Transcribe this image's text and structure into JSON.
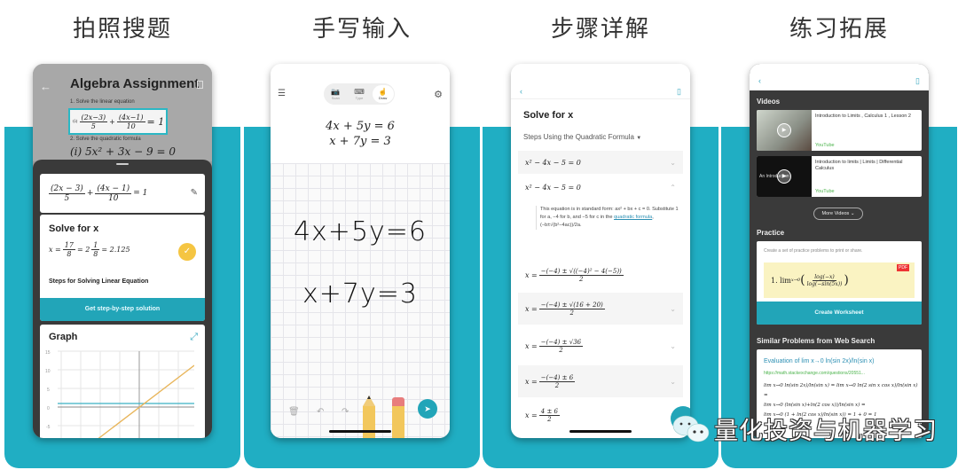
{
  "colors": {
    "teal": "#20aec3",
    "button_teal": "#22a5b8",
    "check_yellow": "#f5c542",
    "link_blue": "#2b8fb3",
    "source_green": "#4bb34b"
  },
  "panels": [
    {
      "title": "拍照搜题",
      "scan": {
        "back_icon": "←",
        "heading": "Algebra Assignment",
        "line1": "1. Solve the linear equation",
        "eq1_label": "(i)",
        "eq1": {
          "a_num": "(2x−3)",
          "a_den": "5",
          "plus": "+",
          "b_num": "(4x−1)",
          "b_den": "10",
          "rhs": "= 1"
        },
        "line2": "2. Solve the quadratic formula",
        "eq2": "(i) 5x² + 3x − 9 = 0"
      },
      "problem_card": {
        "a_num": "(2x − 3)",
        "a_den": "5",
        "plus": "+",
        "b_num": "(4x − 1)",
        "b_den": "10",
        "rhs": "= 1",
        "edit_icon": "✎"
      },
      "solve_card": {
        "title": "Solve for x",
        "result_lhs": "x =",
        "frac_num": "17",
        "frac_den": "8",
        "mixed": "= 2",
        "mixed_num": "1",
        "mixed_den": "8",
        "decimal": "= 2.125",
        "check_icon": "✓",
        "steps_label": "Steps for Solving Linear Equation",
        "button": "Get step-by-step solution"
      },
      "graph_card": {
        "title": "Graph",
        "expand_icon": "⤢",
        "y_ticks": [
          "15",
          "10",
          "5",
          "0",
          "-5"
        ]
      }
    },
    {
      "title": "手写输入",
      "list_icon": "☰",
      "gear_icon": "⚙",
      "modes": [
        {
          "icon": "📷",
          "label": "Scan"
        },
        {
          "icon": "⌨",
          "label": "Type"
        },
        {
          "icon": "☝",
          "label": "Draw"
        }
      ],
      "typed_eq1": "4x + 5y = 6",
      "typed_eq2": "x + 7y = 3",
      "handwritten_eq1": "4x+5y=6",
      "handwritten_eq2": "x+7y=3",
      "toolbar": {
        "trash_icon": "🗑",
        "undo_icon": "↶",
        "redo_icon": "↷",
        "send_icon": "➤"
      }
    },
    {
      "title": "步骤详解",
      "back_icon": "‹",
      "bookmark_icon": "▯",
      "heading": "Solve for x",
      "method": "Steps Using the Quadratic Formula",
      "method_caret": "▼",
      "steps": [
        {
          "expr": "x² − 4x − 5 = 0",
          "chevron": "⌄"
        },
        {
          "expr": "x² − 4x − 5 = 0",
          "chevron": "⌃"
        }
      ],
      "explanation": {
        "text1": "This equation is in standard form: ax² + bx + c = 0. Substitute 1 for a, −4 for b, and −5 for c in the ",
        "link": "quadratic formula",
        "text2": ", (−b±√(b²−4ac))/2a."
      },
      "fractions": [
        {
          "lhs": "x =",
          "num": "−(−4) ± √((−4)² − 4(−5))",
          "den": "2",
          "chevron": ""
        },
        {
          "lhs": "x =",
          "num": "−(−4) ± √(16 + 20)",
          "den": "2",
          "chevron": "⌄"
        },
        {
          "lhs": "x =",
          "num": "−(−4) ± √36",
          "den": "2",
          "chevron": "⌄"
        },
        {
          "lhs": "x =",
          "num": "−(−4) ± 6",
          "den": "2",
          "chevron": "⌄"
        },
        {
          "lhs": "x =",
          "num": "4 ± 6",
          "den": "2",
          "chevron": "⌄"
        }
      ]
    },
    {
      "title": "练习拓展",
      "back_icon": "‹",
      "bookmark_icon": "▯",
      "videos_heading": "Videos",
      "videos": [
        {
          "title": "Introduction to Limits , Calculus 1 , Lesson 2",
          "source": "YouTube",
          "thumb_text": ""
        },
        {
          "title": "Introduction to limits | Limits | Differential Calculus",
          "source": "YouTube",
          "thumb_text": "An Introduction"
        }
      ],
      "more_videos": "More Videos ⌄",
      "practice_heading": "Practice",
      "practice_desc": "Create a set of practice problems to print or share.",
      "practice_problem": "1. lim",
      "practice_sub": "x→0",
      "practice_num": "log(−x)",
      "practice_den": "log(−sin(5x))",
      "pdf_badge": "PDF",
      "worksheet_button": "Create Worksheet",
      "web_heading": "Similar Problems from Web Search",
      "web_result": {
        "title": "Evaluation of lim x→0 ln(sin 2x)/ln(sin x)",
        "url": "https://math.stackexchange.com/questions/20551...",
        "line1": "lim x→0 ln(sin 2x)/ln(sin x) = lim x→0 ln(2 sin x cos x)/ln(sin x) =",
        "line2": "lim x→0 (ln(sin x)+ln(2 cos x))/ln(sin x) =",
        "line3": "lim x→0 (1 + ln(2 cos x)/ln(sin x)) = 1 + 0 = 1"
      }
    }
  ],
  "watermark": "量化投资与机器学习"
}
